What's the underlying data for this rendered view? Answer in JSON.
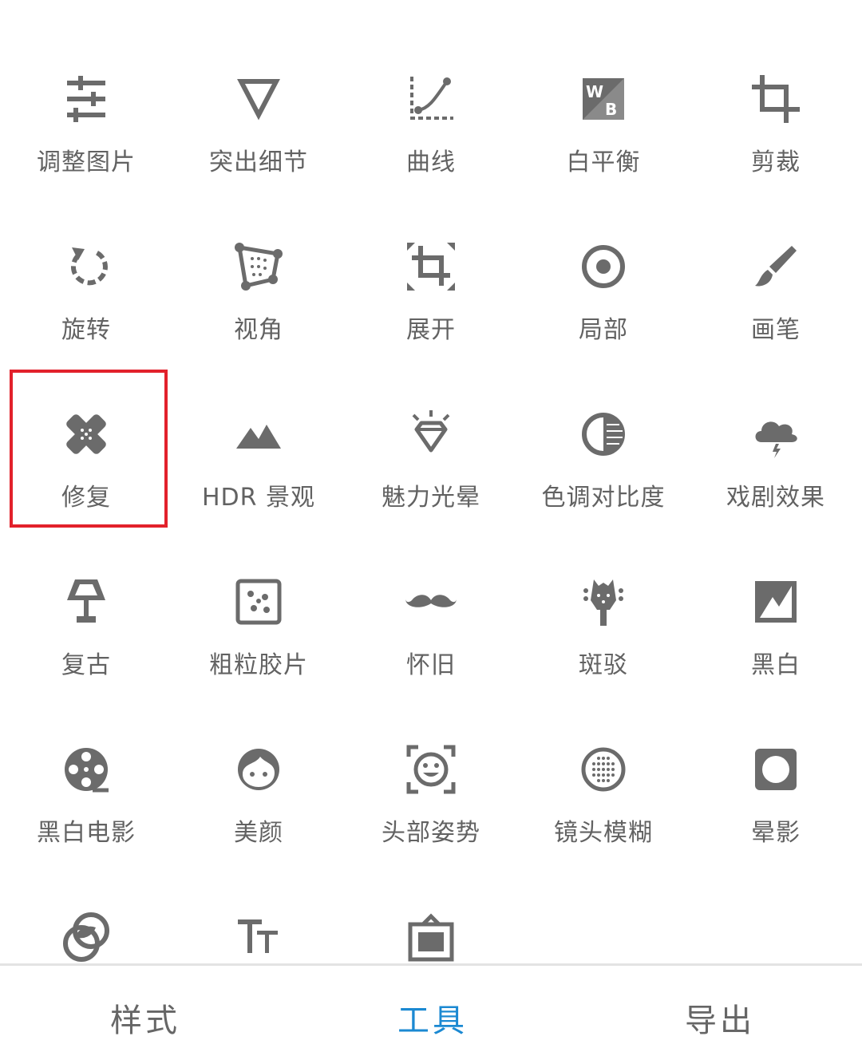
{
  "tools": [
    {
      "id": "adjust",
      "label": "调整图片",
      "icon": "sliders-icon"
    },
    {
      "id": "details",
      "label": "突出细节",
      "icon": "triangle-down-icon"
    },
    {
      "id": "curves",
      "label": "曲线",
      "icon": "curve-icon"
    },
    {
      "id": "white_balance",
      "label": "白平衡",
      "icon": "wb-icon"
    },
    {
      "id": "crop",
      "label": "剪裁",
      "icon": "crop-icon"
    },
    {
      "id": "rotate",
      "label": "旋转",
      "icon": "rotate-icon"
    },
    {
      "id": "perspective",
      "label": "视角",
      "icon": "perspective-icon"
    },
    {
      "id": "expand",
      "label": "展开",
      "icon": "expand-icon"
    },
    {
      "id": "selective",
      "label": "局部",
      "icon": "target-icon"
    },
    {
      "id": "brush",
      "label": "画笔",
      "icon": "brush-icon"
    },
    {
      "id": "healing",
      "label": "修复",
      "icon": "bandage-icon"
    },
    {
      "id": "hdr",
      "label": "HDR 景观",
      "icon": "mountains-icon"
    },
    {
      "id": "glamour",
      "label": "魅力光晕",
      "icon": "diamond-icon"
    },
    {
      "id": "tonal",
      "label": "色调对比度",
      "icon": "contrast-icon"
    },
    {
      "id": "drama",
      "label": "戏剧效果",
      "icon": "storm-cloud-icon"
    },
    {
      "id": "vintage",
      "label": "复古",
      "icon": "lamp-icon"
    },
    {
      "id": "grainy",
      "label": "粗粒胶片",
      "icon": "grain-icon"
    },
    {
      "id": "retrolux",
      "label": "怀旧",
      "icon": "mustache-icon"
    },
    {
      "id": "grunge",
      "label": "斑驳",
      "icon": "guitar-icon"
    },
    {
      "id": "bw",
      "label": "黑白",
      "icon": "bw-icon"
    },
    {
      "id": "noir",
      "label": "黑白电影",
      "icon": "film-reel-icon"
    },
    {
      "id": "face",
      "label": "美颜",
      "icon": "face-icon"
    },
    {
      "id": "head_pose",
      "label": "头部姿势",
      "icon": "smile-frame-icon"
    },
    {
      "id": "lens_blur",
      "label": "镜头模糊",
      "icon": "lens-blur-icon"
    },
    {
      "id": "vignette",
      "label": "晕影",
      "icon": "vignette-icon"
    },
    {
      "id": "double_exposure",
      "label": "",
      "icon": "double-exposure-icon"
    },
    {
      "id": "text",
      "label": "",
      "icon": "text-icon"
    },
    {
      "id": "frames",
      "label": "",
      "icon": "frame-icon"
    }
  ],
  "highlighted_tool": "修复",
  "bottom_nav": {
    "styles": "样式",
    "tools": "工具",
    "export": "导出",
    "active": "工具"
  },
  "colors": {
    "icon": "#6b6b6b",
    "label": "#626262",
    "highlight_border": "#e2212b",
    "active_tab": "#1b89d2"
  }
}
